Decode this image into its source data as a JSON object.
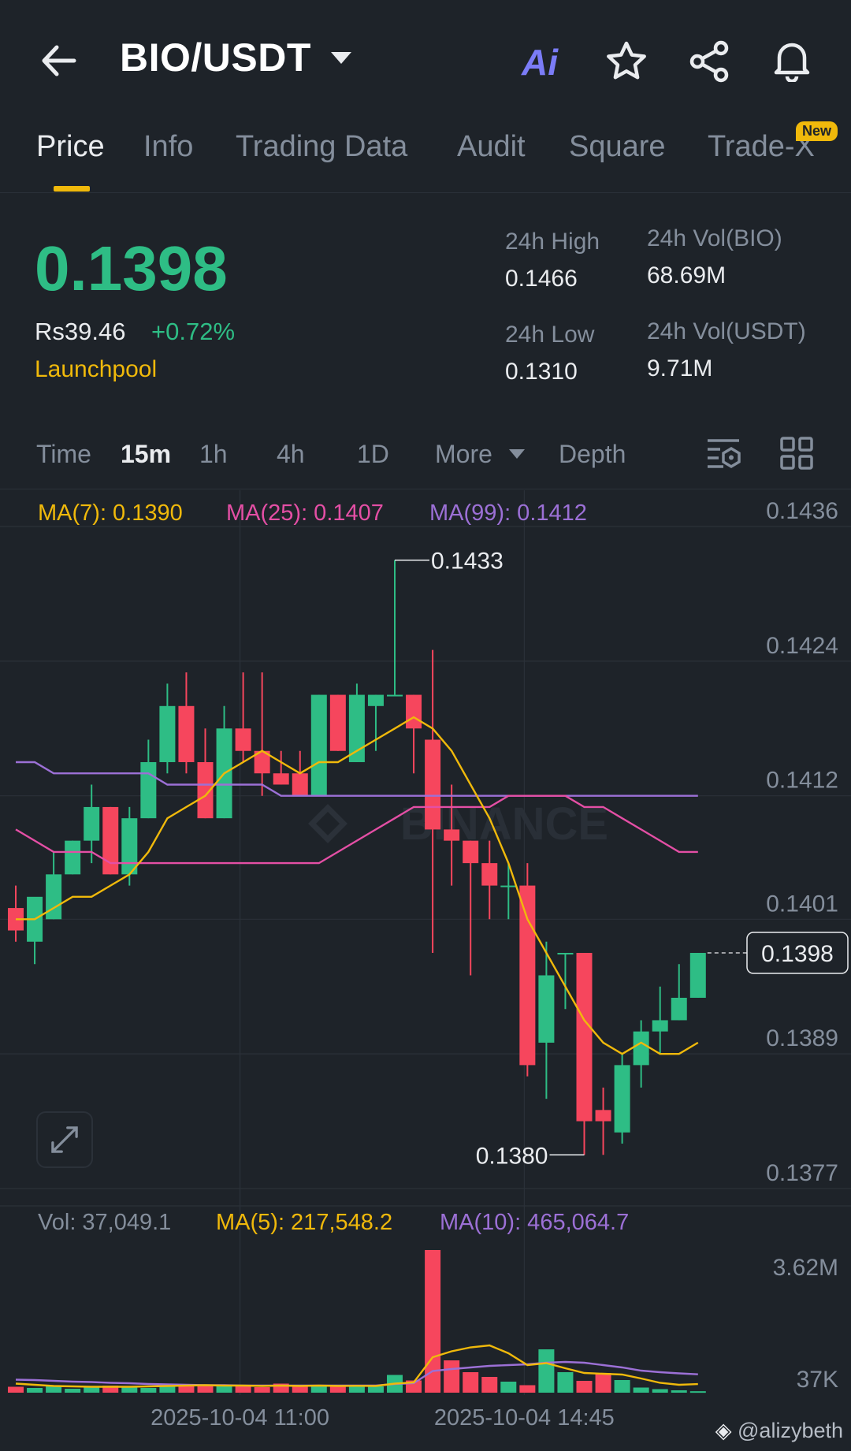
{
  "header": {
    "pair": "BIO/USDT",
    "ai_label": "Ai",
    "icons": [
      "back-arrow-icon",
      "caret-down-icon",
      "ai-icon",
      "star-icon",
      "share-icon",
      "bell-icon"
    ]
  },
  "tabs": [
    {
      "label": "Price",
      "active": true
    },
    {
      "label": "Info"
    },
    {
      "label": "Trading Data"
    },
    {
      "label": "Audit"
    },
    {
      "label": "Square"
    },
    {
      "label": "Trade-X",
      "badge": "New"
    }
  ],
  "ticker": {
    "last_price": "0.1398",
    "fiat_price": "Rs39.46",
    "change": "+0.72%",
    "tag": "Launchpool",
    "high_label": "24h High",
    "high": "0.1466",
    "low_label": "24h Low",
    "low": "0.1310",
    "vol_base_label": "24h Vol(BIO)",
    "vol_base": "68.69M",
    "vol_quote_label": "24h Vol(USDT)",
    "vol_quote": "9.71M"
  },
  "intervals": {
    "time": "Time",
    "m15": "15m",
    "h1": "1h",
    "h4": "4h",
    "d1": "1D",
    "more": "More",
    "depth": "Depth",
    "active": "15m"
  },
  "ma_legend": {
    "ma7": "MA(7): 0.1390",
    "ma25": "MA(25): 0.1407",
    "ma99": "MA(99): 0.1412"
  },
  "vol_legend": {
    "vol": "Vol: 37,049.1",
    "ma5": "MA(5): 217,548.2",
    "ma10": "MA(10): 465,064.7"
  },
  "watermark_user": "@alizybeth",
  "colors": {
    "up": "#2ebd85",
    "down": "#f6465d",
    "ma7": "#f0b90b",
    "ma25": "#e44fa5",
    "ma99": "#9c70d6",
    "accent": "#f0b90b"
  },
  "chart_data": {
    "type": "candlestick",
    "price_axis_ticks": [
      "0.1436",
      "0.1424",
      "0.1412",
      "0.1401",
      "0.1389",
      "0.1377"
    ],
    "price_axis_values": [
      0.1436,
      0.1424,
      0.1412,
      0.1401,
      0.1389,
      0.1377
    ],
    "current_price_label": "0.1398",
    "current_price": 0.1398,
    "high_marker": "0.1433",
    "high_value": 0.1433,
    "low_marker": "0.1380",
    "low_value": 0.138,
    "x_ticks": [
      "2025-10-04 11:00",
      "2025-10-04 14:45"
    ],
    "x_tick_candle_index": [
      12,
      27
    ],
    "volume_axis_ticks": [
      "3.62M",
      "37K"
    ],
    "watermark": "BINANCE",
    "candles": [
      {
        "o": 0.1402,
        "h": 0.1404,
        "l": 0.1399,
        "c": 0.14
      },
      {
        "o": 0.1399,
        "h": 0.1402,
        "l": 0.1397,
        "c": 0.1403
      },
      {
        "o": 0.1401,
        "h": 0.1407,
        "l": 0.1401,
        "c": 0.1405
      },
      {
        "o": 0.1405,
        "h": 0.1408,
        "l": 0.1405,
        "c": 0.1408
      },
      {
        "o": 0.1408,
        "h": 0.1413,
        "l": 0.1406,
        "c": 0.1411
      },
      {
        "o": 0.1411,
        "h": 0.1411,
        "l": 0.1405,
        "c": 0.1405
      },
      {
        "o": 0.1405,
        "h": 0.1411,
        "l": 0.1404,
        "c": 0.141
      },
      {
        "o": 0.141,
        "h": 0.1417,
        "l": 0.141,
        "c": 0.1415
      },
      {
        "o": 0.1415,
        "h": 0.1422,
        "l": 0.1414,
        "c": 0.142
      },
      {
        "o": 0.142,
        "h": 0.1423,
        "l": 0.1414,
        "c": 0.1415
      },
      {
        "o": 0.1415,
        "h": 0.1418,
        "l": 0.141,
        "c": 0.141
      },
      {
        "o": 0.141,
        "h": 0.142,
        "l": 0.141,
        "c": 0.1418
      },
      {
        "o": 0.1418,
        "h": 0.1423,
        "l": 0.1415,
        "c": 0.1416
      },
      {
        "o": 0.1416,
        "h": 0.1423,
        "l": 0.1412,
        "c": 0.1414
      },
      {
        "o": 0.1414,
        "h": 0.1416,
        "l": 0.1413,
        "c": 0.1413
      },
      {
        "o": 0.1414,
        "h": 0.1416,
        "l": 0.1412,
        "c": 0.1412
      },
      {
        "o": 0.1412,
        "h": 0.1421,
        "l": 0.1412,
        "c": 0.1421
      },
      {
        "o": 0.1421,
        "h": 0.1421,
        "l": 0.1416,
        "c": 0.1416
      },
      {
        "o": 0.1415,
        "h": 0.1422,
        "l": 0.1415,
        "c": 0.1421
      },
      {
        "o": 0.142,
        "h": 0.1421,
        "l": 0.1416,
        "c": 0.1421
      },
      {
        "o": 0.1421,
        "h": 0.1433,
        "l": 0.1421,
        "c": 0.1421
      },
      {
        "o": 0.1421,
        "h": 0.1421,
        "l": 0.1414,
        "c": 0.1418
      },
      {
        "o": 0.1417,
        "h": 0.1425,
        "l": 0.1398,
        "c": 0.1409
      },
      {
        "o": 0.1409,
        "h": 0.1413,
        "l": 0.1404,
        "c": 0.1408
      },
      {
        "o": 0.1408,
        "h": 0.1408,
        "l": 0.1396,
        "c": 0.1406
      },
      {
        "o": 0.1406,
        "h": 0.1408,
        "l": 0.1401,
        "c": 0.1404
      },
      {
        "o": 0.1404,
        "h": 0.1406,
        "l": 0.1401,
        "c": 0.1404
      },
      {
        "o": 0.1404,
        "h": 0.1406,
        "l": 0.1387,
        "c": 0.1388
      },
      {
        "o": 0.139,
        "h": 0.1399,
        "l": 0.1385,
        "c": 0.1396
      },
      {
        "o": 0.1398,
        "h": 0.1398,
        "l": 0.1393,
        "c": 0.1398
      },
      {
        "o": 0.1398,
        "h": 0.1398,
        "l": 0.138,
        "c": 0.1383
      },
      {
        "o": 0.1384,
        "h": 0.1386,
        "l": 0.138,
        "c": 0.1383
      },
      {
        "o": 0.1382,
        "h": 0.1389,
        "l": 0.1381,
        "c": 0.1388
      },
      {
        "o": 0.1388,
        "h": 0.1392,
        "l": 0.1386,
        "c": 0.1391
      },
      {
        "o": 0.1391,
        "h": 0.1395,
        "l": 0.1389,
        "c": 0.1392
      },
      {
        "o": 0.1392,
        "h": 0.1397,
        "l": 0.1392,
        "c": 0.1394
      },
      {
        "o": 0.1394,
        "h": 0.1398,
        "l": 0.1394,
        "c": 0.1398
      }
    ],
    "ma7": [
      0.1401,
      0.1401,
      0.1402,
      0.1403,
      0.1403,
      0.1404,
      0.1405,
      0.1407,
      0.141,
      0.1411,
      0.1412,
      0.1414,
      0.1415,
      0.1416,
      0.1415,
      0.1414,
      0.1415,
      0.1415,
      0.1416,
      0.1417,
      0.1418,
      0.1419,
      0.1418,
      0.1416,
      0.1413,
      0.141,
      0.1406,
      0.1401,
      0.1398,
      0.1395,
      0.1392,
      0.139,
      0.1389,
      0.139,
      0.1389,
      0.1389,
      0.139
    ],
    "ma25": [
      0.1409,
      0.1408,
      0.1407,
      0.1407,
      0.1407,
      0.1406,
      0.1406,
      0.1406,
      0.1406,
      0.1406,
      0.1406,
      0.1406,
      0.1406,
      0.1406,
      0.1406,
      0.1406,
      0.1406,
      0.1407,
      0.1408,
      0.1409,
      0.141,
      0.1411,
      0.1411,
      0.1411,
      0.1411,
      0.1411,
      0.1412,
      0.1412,
      0.1412,
      0.1412,
      0.1411,
      0.1411,
      0.141,
      0.1409,
      0.1408,
      0.1407,
      0.1407
    ],
    "ma99": [
      0.1415,
      0.1415,
      0.1414,
      0.1414,
      0.1414,
      0.1414,
      0.1414,
      0.1414,
      0.1413,
      0.1413,
      0.1413,
      0.1413,
      0.1413,
      0.1413,
      0.1412,
      0.1412,
      0.1412,
      0.1412,
      0.1412,
      0.1412,
      0.1412,
      0.1412,
      0.1412,
      0.1412,
      0.1412,
      0.1412,
      0.1412,
      0.1412,
      0.1412,
      0.1412,
      0.1412,
      0.1412,
      0.1412,
      0.1412,
      0.1412,
      0.1412,
      0.1412
    ],
    "volumes": [
      150000,
      120000,
      180000,
      100000,
      150000,
      180000,
      140000,
      120000,
      200000,
      210000,
      180000,
      160000,
      200000,
      140000,
      230000,
      150000,
      170000,
      150000,
      200000,
      160000,
      450000,
      310000,
      3620000,
      820000,
      520000,
      400000,
      280000,
      190000,
      1100000,
      520000,
      300000,
      500000,
      320000,
      130000,
      90000,
      60000,
      37049
    ],
    "vol_ma5": [
      230000,
      200000,
      170000,
      160000,
      150000,
      150000,
      150000,
      160000,
      170000,
      180000,
      190000,
      180000,
      180000,
      170000,
      180000,
      170000,
      180000,
      170000,
      175000,
      170000,
      230000,
      260000,
      900000,
      1050000,
      1150000,
      1200000,
      1000000,
      700000,
      750000,
      620000,
      500000,
      480000,
      460000,
      360000,
      250000,
      200000,
      217548
    ],
    "vol_ma10": [
      330000,
      320000,
      300000,
      280000,
      270000,
      250000,
      240000,
      220000,
      210000,
      200000,
      190000,
      190000,
      180000,
      180000,
      180000,
      180000,
      180000,
      180000,
      180000,
      180000,
      220000,
      240000,
      550000,
      600000,
      640000,
      680000,
      700000,
      720000,
      760000,
      780000,
      760000,
      700000,
      640000,
      560000,
      520000,
      490000,
      465065
    ]
  }
}
